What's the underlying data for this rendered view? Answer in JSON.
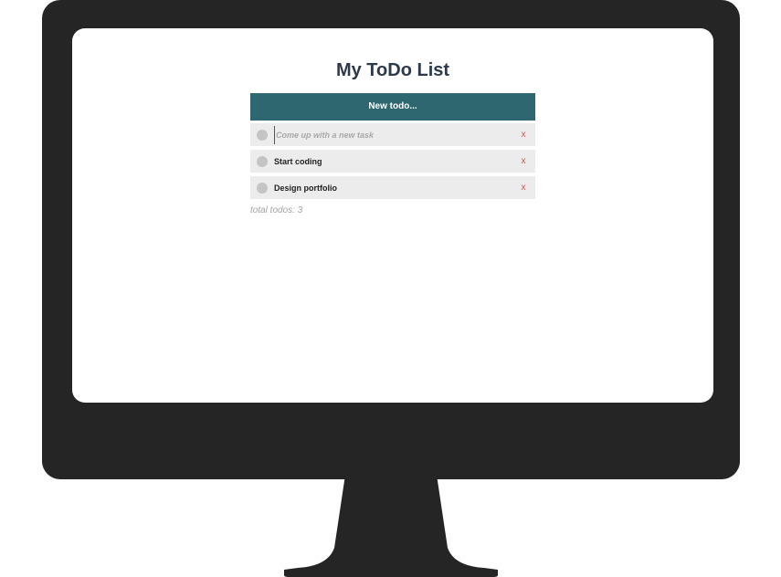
{
  "app": {
    "title": "My ToDo List",
    "new_todo_label": "New todo...",
    "new_task": {
      "placeholder": "Come up with a new task",
      "value": ""
    },
    "delete_label": "x",
    "tasks": [
      {
        "label": "Start coding"
      },
      {
        "label": "Design portfolio"
      }
    ],
    "total_text": "total todos: 3"
  },
  "colors": {
    "monitor": "#252525",
    "header_bar": "#2f6771",
    "title": "#2c3a4b",
    "row_bg": "#ececec",
    "checkbox": "#c4c4c4",
    "delete": "#d9534f"
  }
}
